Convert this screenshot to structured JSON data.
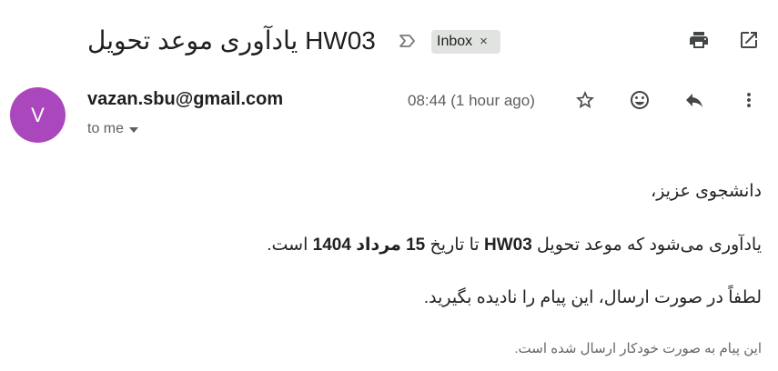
{
  "email": {
    "subject": "یادآوری موعد تحویل HW03",
    "label_chip": "Inbox",
    "chip_close": "×",
    "sender_initial": "V",
    "sender_email": "vazan.sbu@gmail.com",
    "recipient": "to me",
    "timestamp": "08:44 (1 hour ago)"
  },
  "body": {
    "greeting": "دانشجوی عزیز،",
    "line1_a": "یادآوری می‌شود که موعد تحویل ",
    "line1_hw": "HW03",
    "line1_b": " تا تاریخ ",
    "line1_date": "15 مرداد 1404",
    "line1_c": " است.",
    "line2": "لطفاً در صورت ارسال، این پیام را نادیده بگیرید.",
    "footer": "این پیام به صورت خودکار ارسال شده است."
  },
  "icons": {
    "print": "print-icon",
    "open_new_window": "open-in-new-icon",
    "label": "label-arrow-icon",
    "star": "star-icon",
    "emoji": "emoji-icon",
    "reply": "reply-icon",
    "more": "more-vert-icon"
  },
  "colors": {
    "avatar_bg": "#ab47bc",
    "chip_bg": "#e1e3e1"
  }
}
